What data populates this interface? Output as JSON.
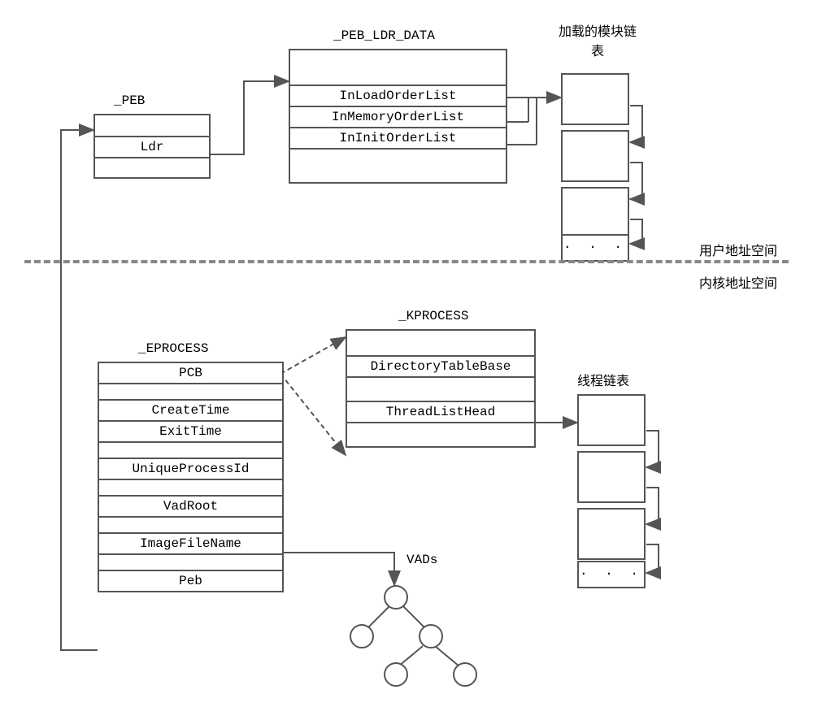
{
  "upper": {
    "peb": {
      "title": "_PEB",
      "field": "Ldr"
    },
    "ldrdata": {
      "title": "_PEB_LDR_DATA",
      "fields": [
        "InLoadOrderList",
        "InMemoryOrderList",
        "InInitOrderList"
      ]
    },
    "module_list_label": "加载的模块链表",
    "space_label": "用户地址空间"
  },
  "lower": {
    "space_label": "内核地址空间",
    "eprocess": {
      "title": "_EPROCESS",
      "fields": [
        "PCB",
        "CreateTime",
        "ExitTime",
        "UniqueProcessId",
        "VadRoot",
        "ImageFileName",
        "Peb"
      ]
    },
    "kprocess": {
      "title": "_KPROCESS",
      "fields": [
        "DirectoryTableBase",
        "ThreadListHead"
      ]
    },
    "thread_list_label": "线程链表",
    "vads_label": "VADs"
  },
  "ellipsis": ". . ."
}
